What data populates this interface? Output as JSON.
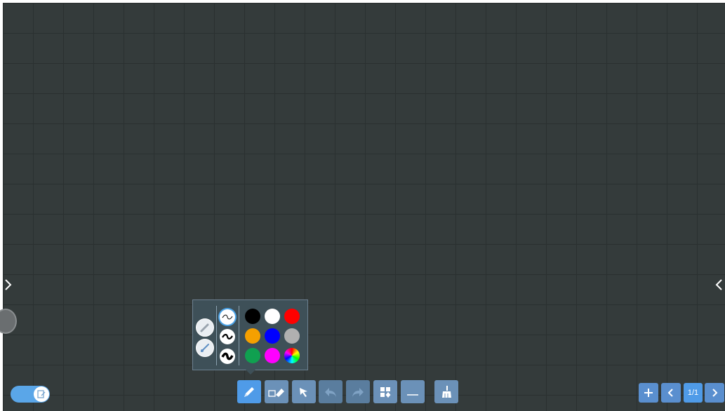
{
  "canvas": {
    "background": "#343b3b",
    "grid_line": "#2a3030"
  },
  "pen_popup": {
    "pen_types": [
      "pencil-pen",
      "brush-pen"
    ],
    "stroke_widths": [
      "thin",
      "medium",
      "thick"
    ],
    "selected_stroke": "thin",
    "colors": [
      {
        "name": "black",
        "hex": "#000000"
      },
      {
        "name": "white",
        "hex": "#ffffff"
      },
      {
        "name": "red",
        "hex": "#ff0000"
      },
      {
        "name": "orange",
        "hex": "#f5a000"
      },
      {
        "name": "blue",
        "hex": "#0000ff"
      },
      {
        "name": "gray",
        "hex": "#b0b0b0"
      },
      {
        "name": "green",
        "hex": "#10a050"
      },
      {
        "name": "magenta",
        "hex": "#ff00ff"
      },
      {
        "name": "custom-color-wheel",
        "hex": "rainbow"
      }
    ]
  },
  "toolbar": {
    "tools": [
      "pen",
      "eraser",
      "select",
      "undo",
      "redo",
      "more-tools",
      "line-tool",
      "clear-all"
    ],
    "active": "pen"
  },
  "pager": {
    "indicator": "1/1"
  },
  "accent": "#4f9be8"
}
